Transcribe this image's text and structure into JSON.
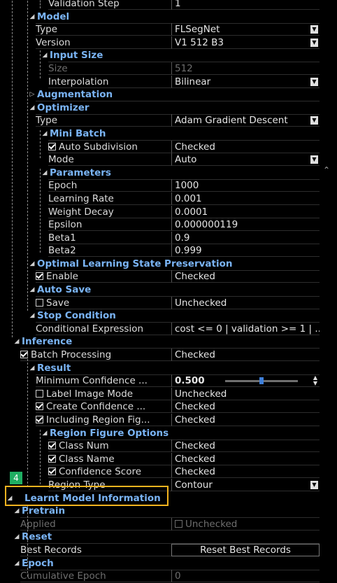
{
  "rows": [
    {
      "type": "prop",
      "indent": 2,
      "name": "Validation Step",
      "value": "1"
    },
    {
      "type": "cat",
      "indent": 1,
      "name": "Model"
    },
    {
      "type": "prop",
      "indent": 1,
      "name": "Type",
      "value": "FLSegNet",
      "dropdown": true
    },
    {
      "type": "prop",
      "indent": 1,
      "name": "Version",
      "value": "V1 512 B3",
      "dropdown": true
    },
    {
      "type": "cat",
      "indent": 2,
      "name": "Input Size"
    },
    {
      "type": "prop",
      "indent": 2,
      "name": "Size",
      "value": "512",
      "disabled": true
    },
    {
      "type": "prop",
      "indent": 2,
      "name": "Interpolation",
      "value": "Bilinear",
      "dropdown": true
    },
    {
      "type": "cat",
      "indent": 1,
      "name": "Augmentation",
      "collapsed": true
    },
    {
      "type": "cat",
      "indent": 1,
      "name": "Optimizer"
    },
    {
      "type": "prop",
      "indent": 1,
      "name": "Type",
      "value": "Adam Gradient Descent",
      "dropdown": true
    },
    {
      "type": "cat",
      "indent": 2,
      "name": "Mini Batch"
    },
    {
      "type": "prop",
      "indent": 2,
      "name": "Auto Subdivision",
      "value": "Checked",
      "check": true
    },
    {
      "type": "prop",
      "indent": 2,
      "name": "Mode",
      "value": "Auto",
      "dropdown": true
    },
    {
      "type": "cat",
      "indent": 2,
      "name": "Parameters"
    },
    {
      "type": "prop",
      "indent": 2,
      "name": "Epoch",
      "value": "1000"
    },
    {
      "type": "prop",
      "indent": 2,
      "name": "Learning Rate",
      "value": "0.001"
    },
    {
      "type": "prop",
      "indent": 2,
      "name": "Weight Decay",
      "value": "0.0001"
    },
    {
      "type": "prop",
      "indent": 2,
      "name": "Epsilon",
      "value": "0.000000119"
    },
    {
      "type": "prop",
      "indent": 2,
      "name": "Beta1",
      "value": "0.9"
    },
    {
      "type": "prop",
      "indent": 2,
      "name": "Beta2",
      "value": "0.999"
    },
    {
      "type": "cat",
      "indent": 1,
      "name": "Optimal Learning State Preservation"
    },
    {
      "type": "prop",
      "indent": 1,
      "name": "Enable",
      "value": "Checked",
      "check": true
    },
    {
      "type": "cat",
      "indent": 1,
      "name": "Auto Save"
    },
    {
      "type": "prop",
      "indent": 1,
      "name": "Save",
      "value": "Unchecked",
      "check": false
    },
    {
      "type": "cat",
      "indent": 1,
      "name": "Stop Condition"
    },
    {
      "type": "prop",
      "indent": 1,
      "name": "Conditional Expression",
      "value": "cost <= 0 | validation >= 1 | ..."
    },
    {
      "type": "cat",
      "indent": 0,
      "name": "Inference"
    },
    {
      "type": "prop",
      "indent": 0,
      "name": "Batch Processing",
      "value": "Checked",
      "check": true
    },
    {
      "type": "cat",
      "indent": 1,
      "name": "Result"
    },
    {
      "type": "prop",
      "indent": 1,
      "name": "Minimum Confidence ...",
      "value": "0.500",
      "slider": true,
      "level": 0.5
    },
    {
      "type": "prop",
      "indent": 1,
      "name": "Label Image Mode",
      "value": "Unchecked",
      "check": false
    },
    {
      "type": "prop",
      "indent": 1,
      "name": "Create Confidence ...",
      "value": "Checked",
      "check": true
    },
    {
      "type": "prop",
      "indent": 1,
      "name": "Including Region Fig...",
      "value": "Checked",
      "check": true
    },
    {
      "type": "cat",
      "indent": 2,
      "name": "Region Figure Options"
    },
    {
      "type": "prop",
      "indent": 2,
      "name": "Class Num",
      "value": "Checked",
      "check": true
    },
    {
      "type": "prop",
      "indent": 2,
      "name": "Class Name",
      "value": "Checked",
      "check": true
    },
    {
      "type": "prop",
      "indent": 2,
      "name": "Confidence Score",
      "value": "Checked",
      "check": true
    },
    {
      "type": "prop",
      "indent": 2,
      "name": "Region Type",
      "value": "Contour",
      "dropdown": true
    },
    {
      "type": "top",
      "indent": 0,
      "name": "Learnt Model Information"
    },
    {
      "type": "cat",
      "indent": 0,
      "name": "Pretrain"
    },
    {
      "type": "prop",
      "indent": 0,
      "name": "Applied",
      "value": "Unchecked",
      "disabled": true,
      "valcheck": false
    },
    {
      "type": "cat",
      "indent": 0,
      "name": "Reset"
    },
    {
      "type": "prop",
      "indent": 0,
      "name": "Best Records",
      "value": "Reset Best Records",
      "button": true
    },
    {
      "type": "cat",
      "indent": 0,
      "name": "Epoch"
    },
    {
      "type": "prop",
      "indent": 0,
      "name": "Cumulative Epoch",
      "value": "0",
      "disabled": true
    }
  ],
  "badge": "4",
  "colors": {
    "category": "#7ab4f5",
    "highlight": "#f3b31f",
    "badge": "#1fae62"
  }
}
